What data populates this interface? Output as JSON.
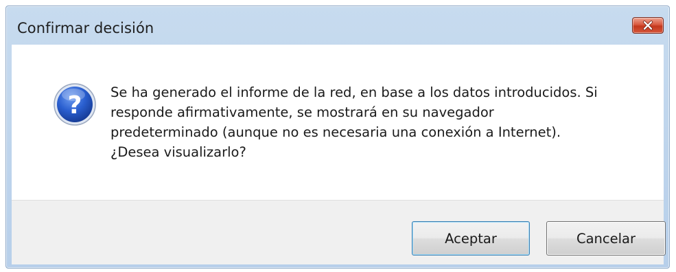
{
  "dialog": {
    "title": "Confirmar decisión",
    "close_icon": "close-icon",
    "icon": "question-icon",
    "message_lines": [
      "Se ha generado el informe de la red, en base a los datos introducidos. Si",
      "responde afirmativamente, se mostrará en su navegador",
      "predeterminado (aunque no es necesaria una conexión a Internet).",
      "¿Desea visualizarlo?"
    ],
    "buttons": {
      "accept_label": "Aceptar",
      "cancel_label": "Cancelar"
    }
  },
  "colors": {
    "title_bar": "#c7dbef",
    "close_button": "#c3381d",
    "footer": "#f0f0f0",
    "icon_blue": "#1f55c7"
  }
}
